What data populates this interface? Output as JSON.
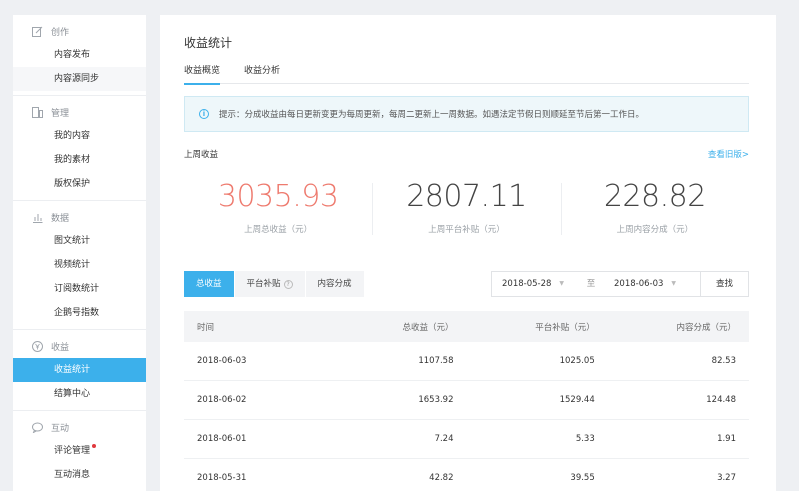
{
  "sidebar": {
    "sections": [
      {
        "icon": "edit-icon",
        "title": "创作",
        "items": [
          {
            "label": "内容发布",
            "active": false,
            "shaded": false
          },
          {
            "label": "内容源同步",
            "active": false,
            "shaded": true
          }
        ]
      },
      {
        "icon": "folder-icon",
        "title": "管理",
        "items": [
          {
            "label": "我的内容"
          },
          {
            "label": "我的素材"
          },
          {
            "label": "版权保护"
          }
        ]
      },
      {
        "icon": "bar-chart-icon",
        "title": "数据",
        "items": [
          {
            "label": "图文统计"
          },
          {
            "label": "视频统计"
          },
          {
            "label": "订阅数统计"
          },
          {
            "label": "企鹅号指数"
          }
        ]
      },
      {
        "icon": "yen-icon",
        "title": "收益",
        "items": [
          {
            "label": "收益统计"
          },
          {
            "label": "结算中心"
          }
        ]
      },
      {
        "icon": "chat-bubble-icon",
        "title": "互动",
        "items": [
          {
            "label": "评论管理"
          },
          {
            "label": "互动消息"
          }
        ]
      }
    ]
  },
  "main": {
    "title": "收益统计",
    "tabs": [
      {
        "label": "收益概览"
      },
      {
        "label": "收益分析"
      }
    ],
    "notice": "提示：分成收益由每日更新变更为每周更新，每周二更新上一周数据。如遇法定节假日则顺延至节后第一工作日。",
    "week_label": "上周收益",
    "history_link": "查看旧版>",
    "stats": [
      {
        "value": "3035.93",
        "label": "上周总收益（元）"
      },
      {
        "value": "2807.11",
        "label": "上周平台补贴（元）"
      },
      {
        "value": "228.82",
        "label": "上周内容分成（元）"
      }
    ],
    "segments": [
      {
        "label": "总收益"
      },
      {
        "label": "平台补贴",
        "help": "?"
      },
      {
        "label": "内容分成"
      }
    ],
    "date_from": "2018-05-28",
    "date_to": "2018-06-03",
    "to_label": "至",
    "search_label": "查找",
    "table": {
      "headers": [
        "时间",
        "总收益（元）",
        "平台补贴（元）",
        "内容分成（元）"
      ],
      "rows": [
        [
          "2018-06-03",
          "1107.58",
          "1025.05",
          "82.53"
        ],
        [
          "2018-06-02",
          "1653.92",
          "1529.44",
          "124.48"
        ],
        [
          "2018-06-01",
          "7.24",
          "5.33",
          "1.91"
        ],
        [
          "2018-05-31",
          "42.82",
          "39.55",
          "3.27"
        ]
      ]
    }
  },
  "colors": {
    "accent": "#3cb0eb",
    "highlight_number": "#ee7a6e",
    "badge_dot": "#e0393e"
  }
}
